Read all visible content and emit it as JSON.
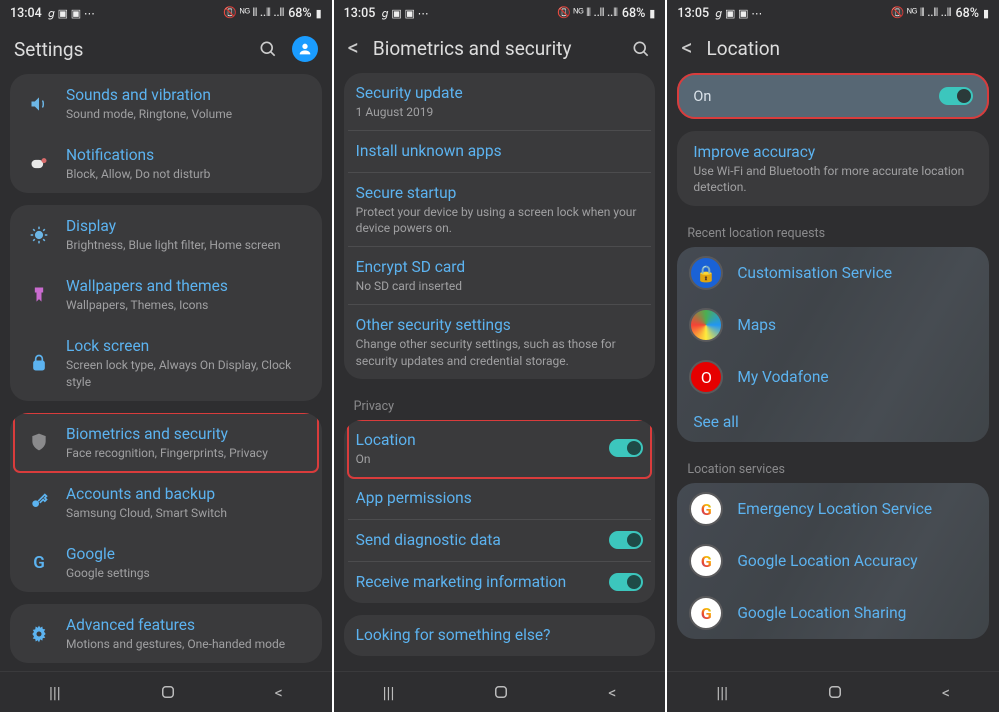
{
  "status": {
    "time_a": "13:04",
    "time_b": "13:05",
    "time_c": "13:05",
    "battery": "68%",
    "left_icons": "𝘨 ▣ ▣ ⋯",
    "right_icons": "📵 ᴺᴳ ⫴ ..⫴ ..⫴"
  },
  "screen1": {
    "title": "Settings",
    "items": [
      {
        "title": "Sounds and vibration",
        "sub": "Sound mode, Ringtone, Volume",
        "icon": "volume"
      },
      {
        "title": "Notifications",
        "sub": "Block, Allow, Do not disturb",
        "icon": "notif"
      },
      {
        "title": "Display",
        "sub": "Brightness, Blue light filter, Home screen",
        "icon": "display"
      },
      {
        "title": "Wallpapers and themes",
        "sub": "Wallpapers, Themes, Icons",
        "icon": "brush"
      },
      {
        "title": "Lock screen",
        "sub": "Screen lock type, Always On Display, Clock style",
        "icon": "lock"
      },
      {
        "title": "Biometrics and security",
        "sub": "Face recognition, Fingerprints, Privacy",
        "icon": "shield",
        "hl": true
      },
      {
        "title": "Accounts and backup",
        "sub": "Samsung Cloud, Smart Switch",
        "icon": "key"
      },
      {
        "title": "Google",
        "sub": "Google settings",
        "icon": "google"
      },
      {
        "title": "Advanced features",
        "sub": "Motions and gestures, One-handed mode",
        "icon": "gear"
      }
    ]
  },
  "screen2": {
    "title": "Biometrics and security",
    "group1": [
      {
        "title": "Security update",
        "sub": "1 August 2019"
      },
      {
        "title": "Install unknown apps"
      },
      {
        "title": "Secure startup",
        "sub": "Protect your device by using a screen lock when your device powers on."
      },
      {
        "title": "Encrypt SD card",
        "sub": "No SD card inserted"
      },
      {
        "title": "Other security settings",
        "sub": "Change other security settings, such as those for security updates and credential storage."
      }
    ],
    "privacy_label": "Privacy",
    "group2": [
      {
        "title": "Location",
        "sub": "On",
        "toggle": true,
        "hl": true
      },
      {
        "title": "App permissions"
      },
      {
        "title": "Send diagnostic data",
        "toggle": true
      },
      {
        "title": "Receive marketing information",
        "toggle": true
      }
    ],
    "footer": "Looking for something else?"
  },
  "screen3": {
    "title": "Location",
    "on": "On",
    "improve_t": "Improve accuracy",
    "improve_s": "Use Wi-Fi and Bluetooth for more accurate location detection.",
    "recent_label": "Recent location requests",
    "recent": [
      {
        "name": "Customisation Service",
        "color": "#1a62d6",
        "glyph": "🔒"
      },
      {
        "name": "Maps",
        "color": "radial",
        "glyph": "🌍"
      },
      {
        "name": "My Vodafone",
        "color": "#e60000",
        "glyph": "O"
      }
    ],
    "see_all": "See all",
    "services_label": "Location services",
    "services": [
      {
        "name": "Emergency Location Service"
      },
      {
        "name": "Google Location Accuracy"
      },
      {
        "name": "Google Location Sharing"
      }
    ]
  }
}
